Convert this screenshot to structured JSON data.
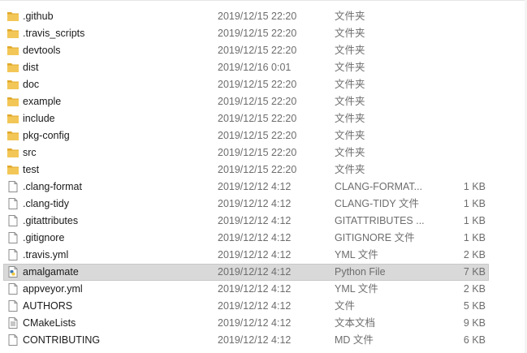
{
  "files": [
    {
      "name": ".github",
      "date": "2019/12/15 22:20",
      "type": "文件夹",
      "size": "",
      "icon": "folder-icon"
    },
    {
      "name": ".travis_scripts",
      "date": "2019/12/15 22:20",
      "type": "文件夹",
      "size": "",
      "icon": "folder-icon"
    },
    {
      "name": "devtools",
      "date": "2019/12/15 22:20",
      "type": "文件夹",
      "size": "",
      "icon": "folder-icon"
    },
    {
      "name": "dist",
      "date": "2019/12/16 0:01",
      "type": "文件夹",
      "size": "",
      "icon": "folder-icon"
    },
    {
      "name": "doc",
      "date": "2019/12/15 22:20",
      "type": "文件夹",
      "size": "",
      "icon": "folder-icon"
    },
    {
      "name": "example",
      "date": "2019/12/15 22:20",
      "type": "文件夹",
      "size": "",
      "icon": "folder-icon"
    },
    {
      "name": "include",
      "date": "2019/12/15 22:20",
      "type": "文件夹",
      "size": "",
      "icon": "folder-icon"
    },
    {
      "name": "pkg-config",
      "date": "2019/12/15 22:20",
      "type": "文件夹",
      "size": "",
      "icon": "folder-icon"
    },
    {
      "name": "src",
      "date": "2019/12/15 22:20",
      "type": "文件夹",
      "size": "",
      "icon": "folder-icon"
    },
    {
      "name": "test",
      "date": "2019/12/15 22:20",
      "type": "文件夹",
      "size": "",
      "icon": "folder-icon"
    },
    {
      "name": ".clang-format",
      "date": "2019/12/12 4:12",
      "type": "CLANG-FORMAT...",
      "size": "1 KB",
      "icon": "file-icon"
    },
    {
      "name": ".clang-tidy",
      "date": "2019/12/12 4:12",
      "type": "CLANG-TIDY 文件",
      "size": "1 KB",
      "icon": "file-icon"
    },
    {
      "name": ".gitattributes",
      "date": "2019/12/12 4:12",
      "type": "GITATTRIBUTES ...",
      "size": "1 KB",
      "icon": "file-icon"
    },
    {
      "name": ".gitignore",
      "date": "2019/12/12 4:12",
      "type": "GITIGNORE 文件",
      "size": "1 KB",
      "icon": "file-icon"
    },
    {
      "name": ".travis.yml",
      "date": "2019/12/12 4:12",
      "type": "YML 文件",
      "size": "2 KB",
      "icon": "file-icon"
    },
    {
      "name": "amalgamate",
      "date": "2019/12/12 4:12",
      "type": "Python File",
      "size": "7 KB",
      "icon": "python-file-icon",
      "selected": true
    },
    {
      "name": "appveyor.yml",
      "date": "2019/12/12 4:12",
      "type": "YML 文件",
      "size": "2 KB",
      "icon": "file-icon"
    },
    {
      "name": "AUTHORS",
      "date": "2019/12/12 4:12",
      "type": "文件",
      "size": "5 KB",
      "icon": "file-icon"
    },
    {
      "name": "CMakeLists",
      "date": "2019/12/12 4:12",
      "type": "文本文档",
      "size": "9 KB",
      "icon": "text-document-icon"
    },
    {
      "name": "CONTRIBUTING",
      "date": "2019/12/12 4:12",
      "type": "MD 文件",
      "size": "6 KB",
      "icon": "file-icon"
    }
  ],
  "colors": {
    "folder": "#f3c757",
    "folder_dark": "#e0a92a",
    "selected_row": "#d9d9d9"
  }
}
